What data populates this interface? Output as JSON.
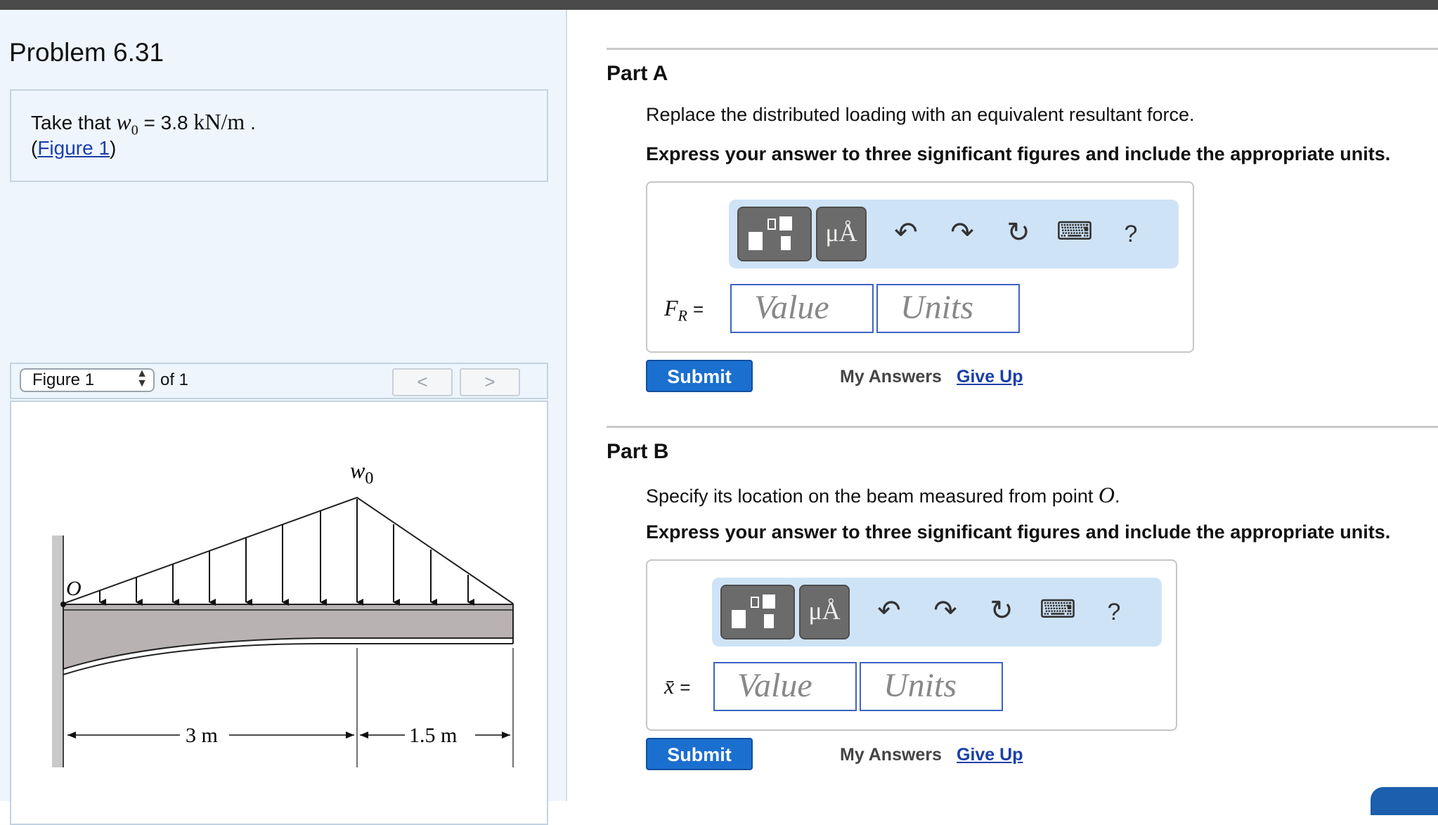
{
  "problem": {
    "title": "Problem 6.31",
    "given_prefix": "Take that",
    "given_var": "w",
    "given_sub": "0",
    "given_value": "= 3.8",
    "given_units": "kN/m",
    "given_suffix": ".",
    "figure_link": "Figure 1"
  },
  "figure_nav": {
    "select_value": "Figure 1",
    "of_text": "of 1",
    "prev": "<",
    "next": ">"
  },
  "figure": {
    "load_label": "w",
    "load_sub": "0",
    "origin_label": "O",
    "dim_left": "3 m",
    "dim_right": "1.5 m"
  },
  "parts": [
    {
      "title": "Part A",
      "prompt": "Replace the distributed loading with an equivalent resultant force.",
      "instruction": "Express your answer to three significant figures and include the appropriate units.",
      "label_var": "F",
      "label_sub": "R",
      "label_eq": "=",
      "value_placeholder": "Value",
      "units_placeholder": "Units",
      "submit": "Submit",
      "my_answers": "My Answers",
      "give_up": "Give Up"
    },
    {
      "title": "Part B",
      "prompt": "Specify its location on the beam measured from point",
      "prompt_point": "O",
      "prompt_end": ".",
      "instruction": "Express your answer to three significant figures and include the appropriate units.",
      "label_var": "x̄",
      "label_eq": "=",
      "value_placeholder": "Value",
      "units_placeholder": "Units",
      "submit": "Submit",
      "my_answers": "My Answers",
      "give_up": "Give Up"
    }
  ],
  "toolbar": {
    "units_button": "μÅ",
    "help": "?"
  },
  "colors": {
    "left_panel_bg": "#eef5fc",
    "toolbar_bg": "#cfe3f7",
    "submit_bg": "#1b6fcf",
    "link": "#1a3fa8",
    "field_border": "#3c63c2"
  }
}
